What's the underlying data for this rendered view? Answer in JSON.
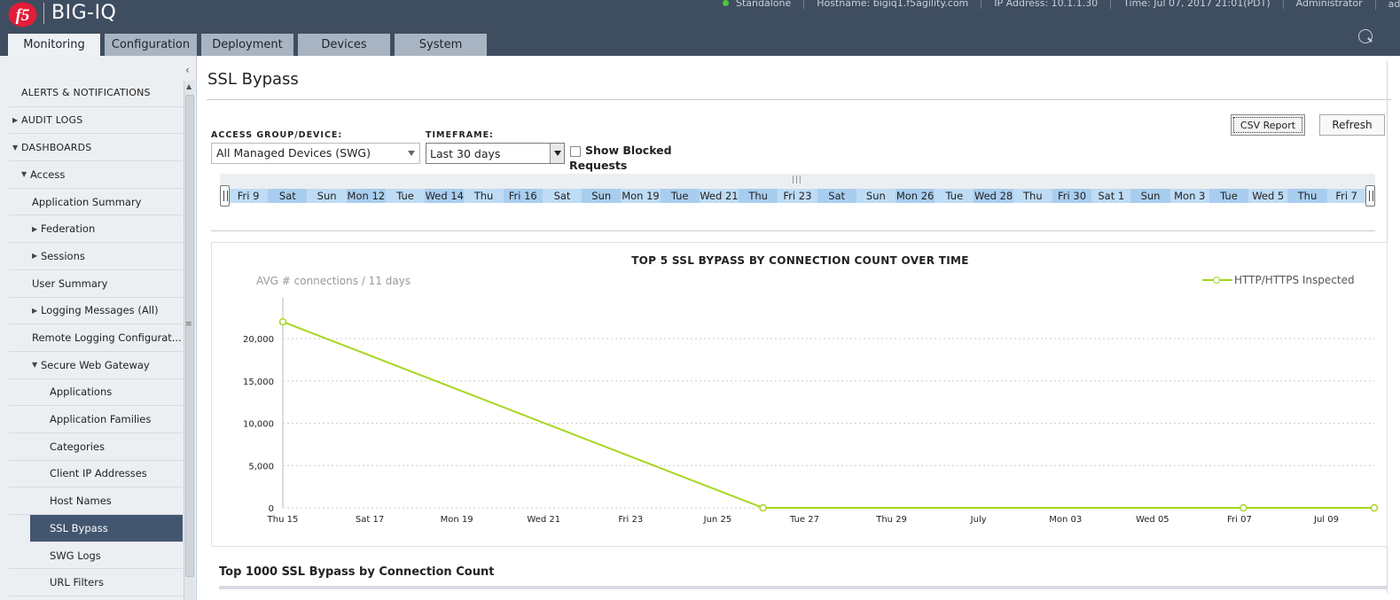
{
  "header": {
    "brand": "BIG-IQ",
    "logo_text": "f5",
    "status": {
      "mode": "Standalone",
      "hostname": "Hostname: bigiq1.f5agility.com",
      "ip": "IP Address: 10.1.1.30",
      "time": "Time: Jul 07, 2017 21:01(PDT)",
      "role": "Administrator",
      "user": "admin"
    },
    "tabs": [
      "Monitoring",
      "Configuration",
      "Deployment",
      "Devices",
      "System"
    ],
    "colors": {
      "bar": "#3f4d60",
      "status_ok": "#4cc53a"
    }
  },
  "sidebar": {
    "items": [
      {
        "label": "ALERTS & NOTIFICATIONS",
        "level": 0,
        "expander": ""
      },
      {
        "label": "AUDIT LOGS",
        "level": 0,
        "expander": "collapsed"
      },
      {
        "label": "DASHBOARDS",
        "level": 0,
        "expander": "expanded"
      },
      {
        "label": "Access",
        "level": 1,
        "expander": "expanded"
      },
      {
        "label": "Application Summary",
        "level": 2,
        "expander": ""
      },
      {
        "label": "Federation",
        "level": 2,
        "expander": "collapsed"
      },
      {
        "label": "Sessions",
        "level": 2,
        "expander": "collapsed"
      },
      {
        "label": "User Summary",
        "level": 2,
        "expander": ""
      },
      {
        "label": "Logging Messages (All)",
        "level": 2,
        "expander": "collapsed"
      },
      {
        "label": "Remote Logging Configurat...",
        "level": 2,
        "expander": ""
      },
      {
        "label": "Secure Web Gateway",
        "level": 2,
        "expander": "expanded"
      },
      {
        "label": "Applications",
        "level": 3,
        "expander": ""
      },
      {
        "label": "Application Families",
        "level": 3,
        "expander": ""
      },
      {
        "label": "Categories",
        "level": 3,
        "expander": ""
      },
      {
        "label": "Client IP Addresses",
        "level": 3,
        "expander": ""
      },
      {
        "label": "Host Names",
        "level": 3,
        "expander": ""
      },
      {
        "label": "SSL Bypass",
        "level": 3,
        "expander": "",
        "selected": true
      },
      {
        "label": "SWG Logs",
        "level": 3,
        "expander": ""
      },
      {
        "label": "URL Filters",
        "level": 3,
        "expander": ""
      }
    ]
  },
  "main": {
    "title": "SSL Bypass",
    "csv_button": "CSV Report",
    "refresh_button": "Refresh",
    "device_label": "ACCESS GROUP/DEVICE:",
    "device_value": "All Managed Devices (SWG)",
    "timeframe_label": "TIMEFRAME:",
    "timeframe_value": "Last 30 days",
    "blocked_label": "Show Blocked Requests",
    "blocked_checked": false,
    "timeline_days": [
      "Fri 9",
      "Sat",
      "Sun",
      "Mon 12",
      "Tue",
      "Wed 14",
      "Thu",
      "Fri 16",
      "Sat",
      "Sun",
      "Mon 19",
      "Tue",
      "Wed 21",
      "Thu",
      "Fri 23",
      "Sat",
      "Sun",
      "Mon 26",
      "Tue",
      "Wed 28",
      "Thu",
      "Fri 30",
      "Sat 1",
      "Sun",
      "Mon 3",
      "Tue",
      "Wed 5",
      "Thu",
      "Fri 7"
    ],
    "table_title": "Top 1000 SSL Bypass by Connection Count"
  },
  "chart_data": {
    "type": "line",
    "title": "TOP 5 SSL BYPASS BY CONNECTION COUNT OVER TIME",
    "subtitle": "AVG # connections / 11 days",
    "x_ticks": [
      "Thu 15",
      "Sat 17",
      "Mon 19",
      "Wed 21",
      "Fri 23",
      "Jun 25",
      "Tue 27",
      "Thu 29",
      "July",
      "Mon 03",
      "Wed 05",
      "Fri 07",
      "Jul 09"
    ],
    "y_ticks": [
      "0",
      "5,000",
      "10,000",
      "15,000",
      "20,000"
    ],
    "ylim": [
      0,
      24000
    ],
    "grid": true,
    "legend_position": "top-right",
    "series": [
      {
        "name": "HTTP/HTTPS Inspected",
        "color": "#a6d61e",
        "points": [
          {
            "x": "2017-06-15",
            "y": 22000
          },
          {
            "x": "2017-06-26",
            "y": 0
          },
          {
            "x": "2017-07-07",
            "y": 0
          },
          {
            "x": "2017-07-10",
            "y": 0
          }
        ]
      }
    ]
  }
}
